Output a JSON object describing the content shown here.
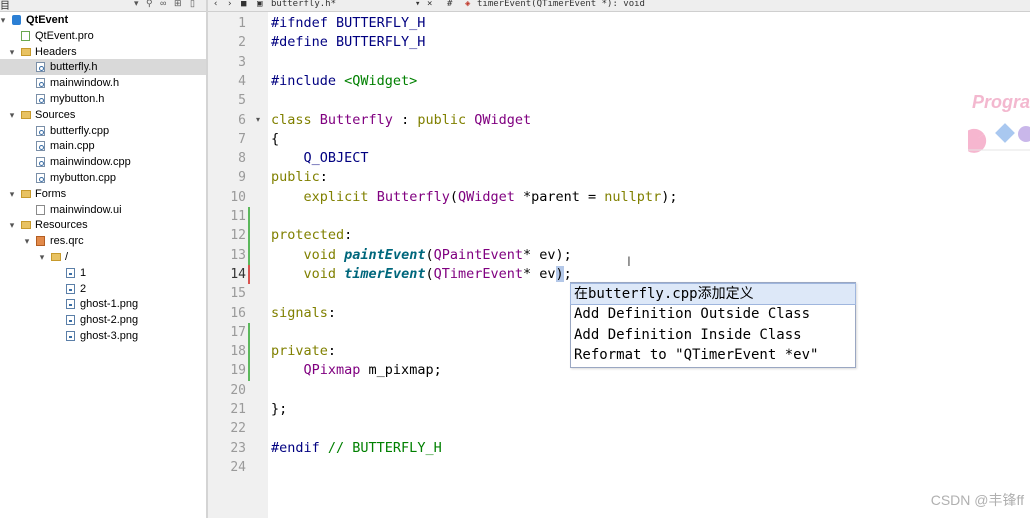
{
  "sidebar": {
    "header_label": "目",
    "tree": [
      {
        "label": "QtEvent",
        "depth": 0,
        "arrow": "▾",
        "icon": "project-icon",
        "bold": true
      },
      {
        "label": "QtEvent.pro",
        "depth": 1,
        "arrow": "",
        "icon": "pro-file-icon"
      },
      {
        "label": "Headers",
        "depth": 1,
        "arrow": "▾",
        "icon": "folder-icon"
      },
      {
        "label": "butterfly.h",
        "depth": 2,
        "arrow": "",
        "icon": "header-file-icon",
        "selected": true
      },
      {
        "label": "mainwindow.h",
        "depth": 2,
        "arrow": "",
        "icon": "header-file-icon"
      },
      {
        "label": "mybutton.h",
        "depth": 2,
        "arrow": "",
        "icon": "header-file-icon"
      },
      {
        "label": "Sources",
        "depth": 1,
        "arrow": "▾",
        "icon": "folder-icon"
      },
      {
        "label": "butterfly.cpp",
        "depth": 2,
        "arrow": "",
        "icon": "source-file-icon"
      },
      {
        "label": "main.cpp",
        "depth": 2,
        "arrow": "",
        "icon": "source-file-icon"
      },
      {
        "label": "mainwindow.cpp",
        "depth": 2,
        "arrow": "",
        "icon": "source-file-icon"
      },
      {
        "label": "mybutton.cpp",
        "depth": 2,
        "arrow": "",
        "icon": "source-file-icon"
      },
      {
        "label": "Forms",
        "depth": 1,
        "arrow": "▾",
        "icon": "folder-icon"
      },
      {
        "label": "mainwindow.ui",
        "depth": 2,
        "arrow": "",
        "icon": "form-file-icon"
      },
      {
        "label": "Resources",
        "depth": 1,
        "arrow": "▾",
        "icon": "folder-icon"
      },
      {
        "label": "res.qrc",
        "depth": 2,
        "arrow": "▾",
        "icon": "resource-file-icon"
      },
      {
        "label": "/",
        "depth": 3,
        "arrow": "▾",
        "icon": "folder-icon"
      },
      {
        "label": "1",
        "depth": 4,
        "arrow": "",
        "icon": "image-file-icon"
      },
      {
        "label": "2",
        "depth": 4,
        "arrow": "",
        "icon": "image-file-icon"
      },
      {
        "label": "ghost-1.png",
        "depth": 4,
        "arrow": "",
        "icon": "image-file-icon"
      },
      {
        "label": "ghost-2.png",
        "depth": 4,
        "arrow": "",
        "icon": "image-file-icon"
      },
      {
        "label": "ghost-3.png",
        "depth": 4,
        "arrow": "",
        "icon": "image-file-icon"
      }
    ]
  },
  "editor_toolbar": {
    "file_tab": "butterfly.h*",
    "hash": "#",
    "symbol": "timerEvent(QTimerEvent *): void"
  },
  "code": {
    "current_line": 14,
    "lines": [
      {
        "n": "1",
        "tokens": [
          {
            "t": "#ifndef BUTTERFLY_H",
            "c": "pp"
          }
        ]
      },
      {
        "n": "2",
        "tokens": [
          {
            "t": "#define BUTTERFLY_H",
            "c": "pp"
          }
        ]
      },
      {
        "n": "3",
        "tokens": []
      },
      {
        "n": "4",
        "tokens": [
          {
            "t": "#include ",
            "c": "pp"
          },
          {
            "t": "<QWidget>",
            "c": "str"
          }
        ]
      },
      {
        "n": "5",
        "tokens": []
      },
      {
        "n": "6",
        "tokens": [
          {
            "t": "class",
            "c": "kw"
          },
          {
            "t": " "
          },
          {
            "t": "Butterfly",
            "c": "typ"
          },
          {
            "t": " : "
          },
          {
            "t": "public",
            "c": "kw"
          },
          {
            "t": " "
          },
          {
            "t": "QWidget",
            "c": "typ"
          }
        ],
        "fold": true
      },
      {
        "n": "7",
        "tokens": [
          {
            "t": "{"
          }
        ]
      },
      {
        "n": "8",
        "tokens": [
          {
            "t": "    "
          },
          {
            "t": "Q_OBJECT",
            "c": "mac"
          }
        ]
      },
      {
        "n": "9",
        "tokens": [
          {
            "t": "public",
            "c": "kw"
          },
          {
            "t": ":"
          }
        ]
      },
      {
        "n": "10",
        "tokens": [
          {
            "t": "    "
          },
          {
            "t": "explicit",
            "c": "kw"
          },
          {
            "t": " "
          },
          {
            "t": "Butterfly",
            "c": "typ"
          },
          {
            "t": "("
          },
          {
            "t": "QWidget",
            "c": "typ"
          },
          {
            "t": " *parent = "
          },
          {
            "t": "nullptr",
            "c": "kw"
          },
          {
            "t": ");"
          }
        ]
      },
      {
        "n": "11",
        "tokens": [],
        "mark": "green"
      },
      {
        "n": "12",
        "tokens": [
          {
            "t": "protected",
            "c": "kw"
          },
          {
            "t": ":"
          }
        ],
        "mark": "green"
      },
      {
        "n": "13",
        "tokens": [
          {
            "t": "    "
          },
          {
            "t": "void",
            "c": "kw"
          },
          {
            "t": " "
          },
          {
            "t": "paintEvent",
            "c": "fn"
          },
          {
            "t": "("
          },
          {
            "t": "QPaintEvent",
            "c": "typ"
          },
          {
            "t": "* ev);"
          }
        ],
        "mark": "green"
      },
      {
        "n": "14",
        "tokens": [
          {
            "t": "    "
          },
          {
            "t": "void",
            "c": "kw"
          },
          {
            "t": " "
          },
          {
            "t": "timerEvent",
            "c": "fn"
          },
          {
            "t": "("
          },
          {
            "t": "QTimerEvent",
            "c": "typ"
          },
          {
            "t": "* ev"
          },
          {
            "t": ")",
            "c": "hl"
          },
          {
            "t": ";"
          }
        ],
        "mark": "red"
      },
      {
        "n": "15",
        "tokens": []
      },
      {
        "n": "16",
        "tokens": [
          {
            "t": "signals",
            "c": "kw"
          },
          {
            "t": ":"
          }
        ]
      },
      {
        "n": "17",
        "tokens": [],
        "mark": "green"
      },
      {
        "n": "18",
        "tokens": [
          {
            "t": "private",
            "c": "kw"
          },
          {
            "t": ":"
          }
        ],
        "mark": "green"
      },
      {
        "n": "19",
        "tokens": [
          {
            "t": "    "
          },
          {
            "t": "QPixmap",
            "c": "typ"
          },
          {
            "t": " m_pixmap;"
          }
        ],
        "mark": "green"
      },
      {
        "n": "20",
        "tokens": []
      },
      {
        "n": "21",
        "tokens": [
          {
            "t": "};"
          }
        ]
      },
      {
        "n": "22",
        "tokens": []
      },
      {
        "n": "23",
        "tokens": [
          {
            "t": "#endif",
            "c": "pp"
          },
          {
            "t": " // BUTTERFLY_H",
            "c": "cm"
          }
        ]
      },
      {
        "n": "24",
        "tokens": []
      }
    ]
  },
  "completion": {
    "items": [
      {
        "label": "在butterfly.cpp添加定义",
        "selected": true
      },
      {
        "label": "Add Definition Outside Class"
      },
      {
        "label": "Add Definition Inside Class"
      },
      {
        "label": "Reformat to \"QTimerEvent *ev\""
      }
    ]
  },
  "logo": {
    "text": "Progra"
  },
  "watermark": "CSDN @丰锋ff"
}
